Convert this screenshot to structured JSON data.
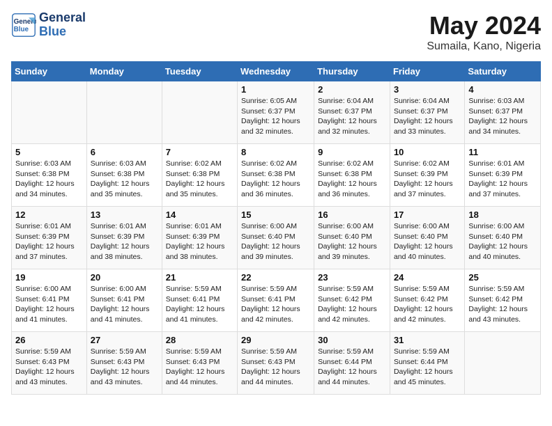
{
  "header": {
    "logo_line1": "General",
    "logo_line2": "Blue",
    "month_year": "May 2024",
    "location": "Sumaila, Kano, Nigeria"
  },
  "days_of_week": [
    "Sunday",
    "Monday",
    "Tuesday",
    "Wednesday",
    "Thursday",
    "Friday",
    "Saturday"
  ],
  "weeks": [
    [
      {
        "day": "",
        "info": ""
      },
      {
        "day": "",
        "info": ""
      },
      {
        "day": "",
        "info": ""
      },
      {
        "day": "1",
        "info": "Sunrise: 6:05 AM\nSunset: 6:37 PM\nDaylight: 12 hours\nand 32 minutes."
      },
      {
        "day": "2",
        "info": "Sunrise: 6:04 AM\nSunset: 6:37 PM\nDaylight: 12 hours\nand 32 minutes."
      },
      {
        "day": "3",
        "info": "Sunrise: 6:04 AM\nSunset: 6:37 PM\nDaylight: 12 hours\nand 33 minutes."
      },
      {
        "day": "4",
        "info": "Sunrise: 6:03 AM\nSunset: 6:37 PM\nDaylight: 12 hours\nand 34 minutes."
      }
    ],
    [
      {
        "day": "5",
        "info": "Sunrise: 6:03 AM\nSunset: 6:38 PM\nDaylight: 12 hours\nand 34 minutes."
      },
      {
        "day": "6",
        "info": "Sunrise: 6:03 AM\nSunset: 6:38 PM\nDaylight: 12 hours\nand 35 minutes."
      },
      {
        "day": "7",
        "info": "Sunrise: 6:02 AM\nSunset: 6:38 PM\nDaylight: 12 hours\nand 35 minutes."
      },
      {
        "day": "8",
        "info": "Sunrise: 6:02 AM\nSunset: 6:38 PM\nDaylight: 12 hours\nand 36 minutes."
      },
      {
        "day": "9",
        "info": "Sunrise: 6:02 AM\nSunset: 6:38 PM\nDaylight: 12 hours\nand 36 minutes."
      },
      {
        "day": "10",
        "info": "Sunrise: 6:02 AM\nSunset: 6:39 PM\nDaylight: 12 hours\nand 37 minutes."
      },
      {
        "day": "11",
        "info": "Sunrise: 6:01 AM\nSunset: 6:39 PM\nDaylight: 12 hours\nand 37 minutes."
      }
    ],
    [
      {
        "day": "12",
        "info": "Sunrise: 6:01 AM\nSunset: 6:39 PM\nDaylight: 12 hours\nand 37 minutes."
      },
      {
        "day": "13",
        "info": "Sunrise: 6:01 AM\nSunset: 6:39 PM\nDaylight: 12 hours\nand 38 minutes."
      },
      {
        "day": "14",
        "info": "Sunrise: 6:01 AM\nSunset: 6:39 PM\nDaylight: 12 hours\nand 38 minutes."
      },
      {
        "day": "15",
        "info": "Sunrise: 6:00 AM\nSunset: 6:40 PM\nDaylight: 12 hours\nand 39 minutes."
      },
      {
        "day": "16",
        "info": "Sunrise: 6:00 AM\nSunset: 6:40 PM\nDaylight: 12 hours\nand 39 minutes."
      },
      {
        "day": "17",
        "info": "Sunrise: 6:00 AM\nSunset: 6:40 PM\nDaylight: 12 hours\nand 40 minutes."
      },
      {
        "day": "18",
        "info": "Sunrise: 6:00 AM\nSunset: 6:40 PM\nDaylight: 12 hours\nand 40 minutes."
      }
    ],
    [
      {
        "day": "19",
        "info": "Sunrise: 6:00 AM\nSunset: 6:41 PM\nDaylight: 12 hours\nand 41 minutes."
      },
      {
        "day": "20",
        "info": "Sunrise: 6:00 AM\nSunset: 6:41 PM\nDaylight: 12 hours\nand 41 minutes."
      },
      {
        "day": "21",
        "info": "Sunrise: 5:59 AM\nSunset: 6:41 PM\nDaylight: 12 hours\nand 41 minutes."
      },
      {
        "day": "22",
        "info": "Sunrise: 5:59 AM\nSunset: 6:41 PM\nDaylight: 12 hours\nand 42 minutes."
      },
      {
        "day": "23",
        "info": "Sunrise: 5:59 AM\nSunset: 6:42 PM\nDaylight: 12 hours\nand 42 minutes."
      },
      {
        "day": "24",
        "info": "Sunrise: 5:59 AM\nSunset: 6:42 PM\nDaylight: 12 hours\nand 42 minutes."
      },
      {
        "day": "25",
        "info": "Sunrise: 5:59 AM\nSunset: 6:42 PM\nDaylight: 12 hours\nand 43 minutes."
      }
    ],
    [
      {
        "day": "26",
        "info": "Sunrise: 5:59 AM\nSunset: 6:43 PM\nDaylight: 12 hours\nand 43 minutes."
      },
      {
        "day": "27",
        "info": "Sunrise: 5:59 AM\nSunset: 6:43 PM\nDaylight: 12 hours\nand 43 minutes."
      },
      {
        "day": "28",
        "info": "Sunrise: 5:59 AM\nSunset: 6:43 PM\nDaylight: 12 hours\nand 44 minutes."
      },
      {
        "day": "29",
        "info": "Sunrise: 5:59 AM\nSunset: 6:43 PM\nDaylight: 12 hours\nand 44 minutes."
      },
      {
        "day": "30",
        "info": "Sunrise: 5:59 AM\nSunset: 6:44 PM\nDaylight: 12 hours\nand 44 minutes."
      },
      {
        "day": "31",
        "info": "Sunrise: 5:59 AM\nSunset: 6:44 PM\nDaylight: 12 hours\nand 45 minutes."
      },
      {
        "day": "",
        "info": ""
      }
    ]
  ]
}
